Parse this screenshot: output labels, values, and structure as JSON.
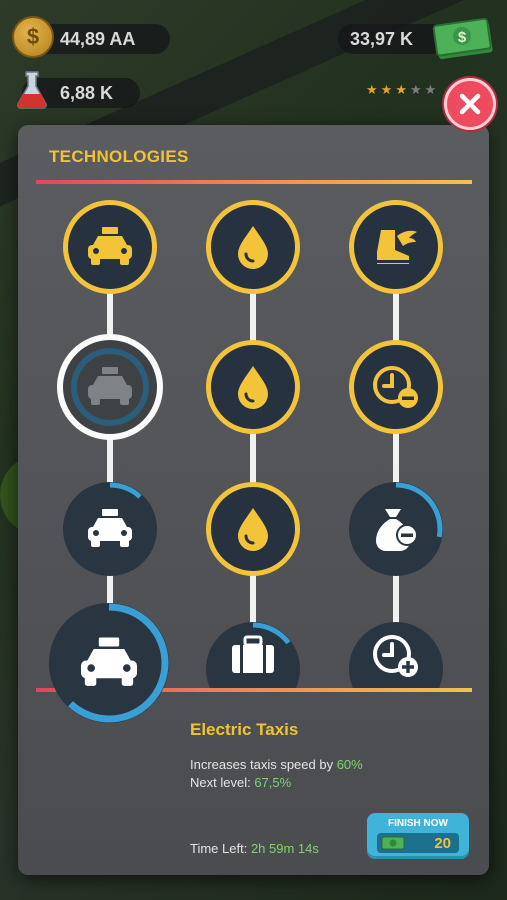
{
  "hud": {
    "coins": "44,89 AA",
    "research": "6,88 K",
    "cash": "33,97 K",
    "rating_stars": 3,
    "rating_max": 5
  },
  "panel": {
    "title": "TECHNOLOGIES"
  },
  "tree": {
    "columns": [
      {
        "nodes": [
          {
            "icon": "taxi-icon",
            "state": "unlocked"
          },
          {
            "icon": "taxi-icon",
            "state": "selected"
          },
          {
            "icon": "taxi-icon",
            "state": "in-progress",
            "progress": 0.12
          },
          {
            "icon": "ticket-icon",
            "state": "locked"
          }
        ]
      },
      {
        "nodes": [
          {
            "icon": "fuel-drop-icon",
            "state": "unlocked"
          },
          {
            "icon": "fuel-drop-icon",
            "state": "unlocked"
          },
          {
            "icon": "fuel-drop-icon",
            "state": "unlocked"
          },
          {
            "icon": "luggage-icon",
            "state": "in-progress",
            "progress": 0.15
          }
        ]
      },
      {
        "nodes": [
          {
            "icon": "winged-boot-icon",
            "state": "unlocked"
          },
          {
            "icon": "clock-minus-icon",
            "state": "unlocked"
          },
          {
            "icon": "money-bag-minus-icon",
            "state": "in-progress",
            "progress": 0.28
          },
          {
            "icon": "clock-plus-icon",
            "state": "locked"
          }
        ]
      }
    ]
  },
  "detail": {
    "title": "Electric Taxis",
    "desc_prefix": "Increases taxis speed by",
    "desc_value": "60%",
    "next_prefix": "Next level:",
    "next_value": "67,5%",
    "time_prefix": "Time Left:",
    "time_value": "2h 59m 14s",
    "progress": 0.62
  },
  "finish": {
    "label": "FINISH NOW",
    "cost": "20"
  },
  "colors": {
    "gold": "#f3c43a",
    "accent_green": "#7fd46b",
    "close_red": "#ef4b5e",
    "finish_blue": "#3fb4d8",
    "progress_blue": "#3a9fd6"
  }
}
